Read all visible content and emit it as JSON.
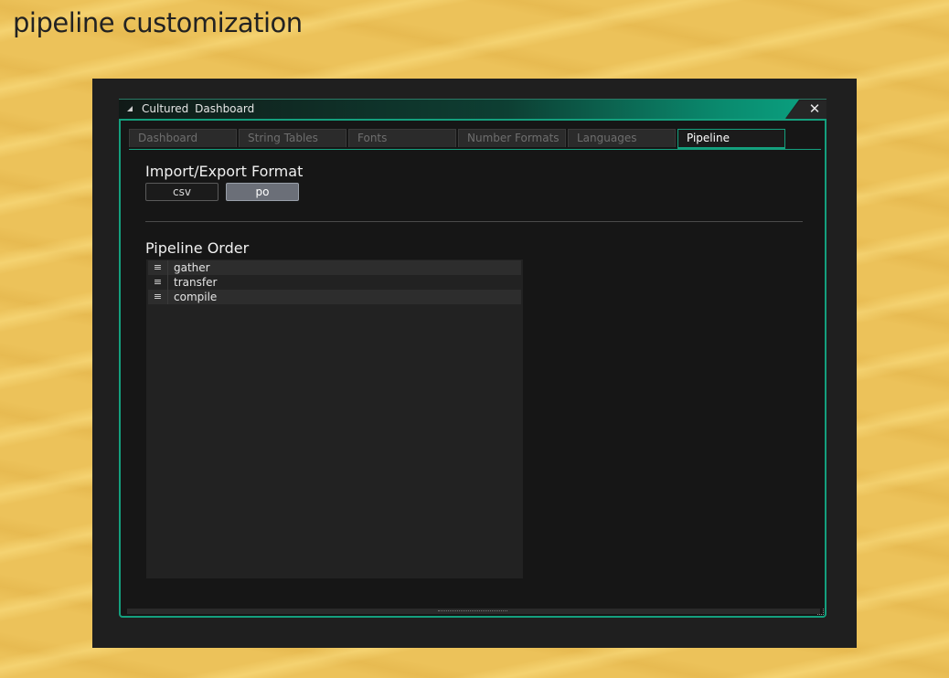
{
  "page": {
    "title": "pipeline customization"
  },
  "window": {
    "title": "Cultured Dashboard",
    "close_glyph": "✕"
  },
  "tabs": [
    {
      "label": "Dashboard",
      "active": false
    },
    {
      "label": "String Tables",
      "active": false
    },
    {
      "label": "Fonts",
      "active": false
    },
    {
      "label": "Number Formats",
      "active": false
    },
    {
      "label": "Languages",
      "active": false
    },
    {
      "label": "Pipeline",
      "active": true
    }
  ],
  "import_export": {
    "heading": "Import/Export Format",
    "options": [
      {
        "label": "csv",
        "selected": false
      },
      {
        "label": "po",
        "selected": true
      }
    ]
  },
  "pipeline_order": {
    "heading": "Pipeline Order",
    "handle_glyph": "≡",
    "items": [
      {
        "label": "gather"
      },
      {
        "label": "transfer"
      },
      {
        "label": "compile"
      }
    ]
  },
  "colors": {
    "accent": "#14a07e",
    "background": "#ecc25a",
    "panel": "#1b1b1b"
  }
}
